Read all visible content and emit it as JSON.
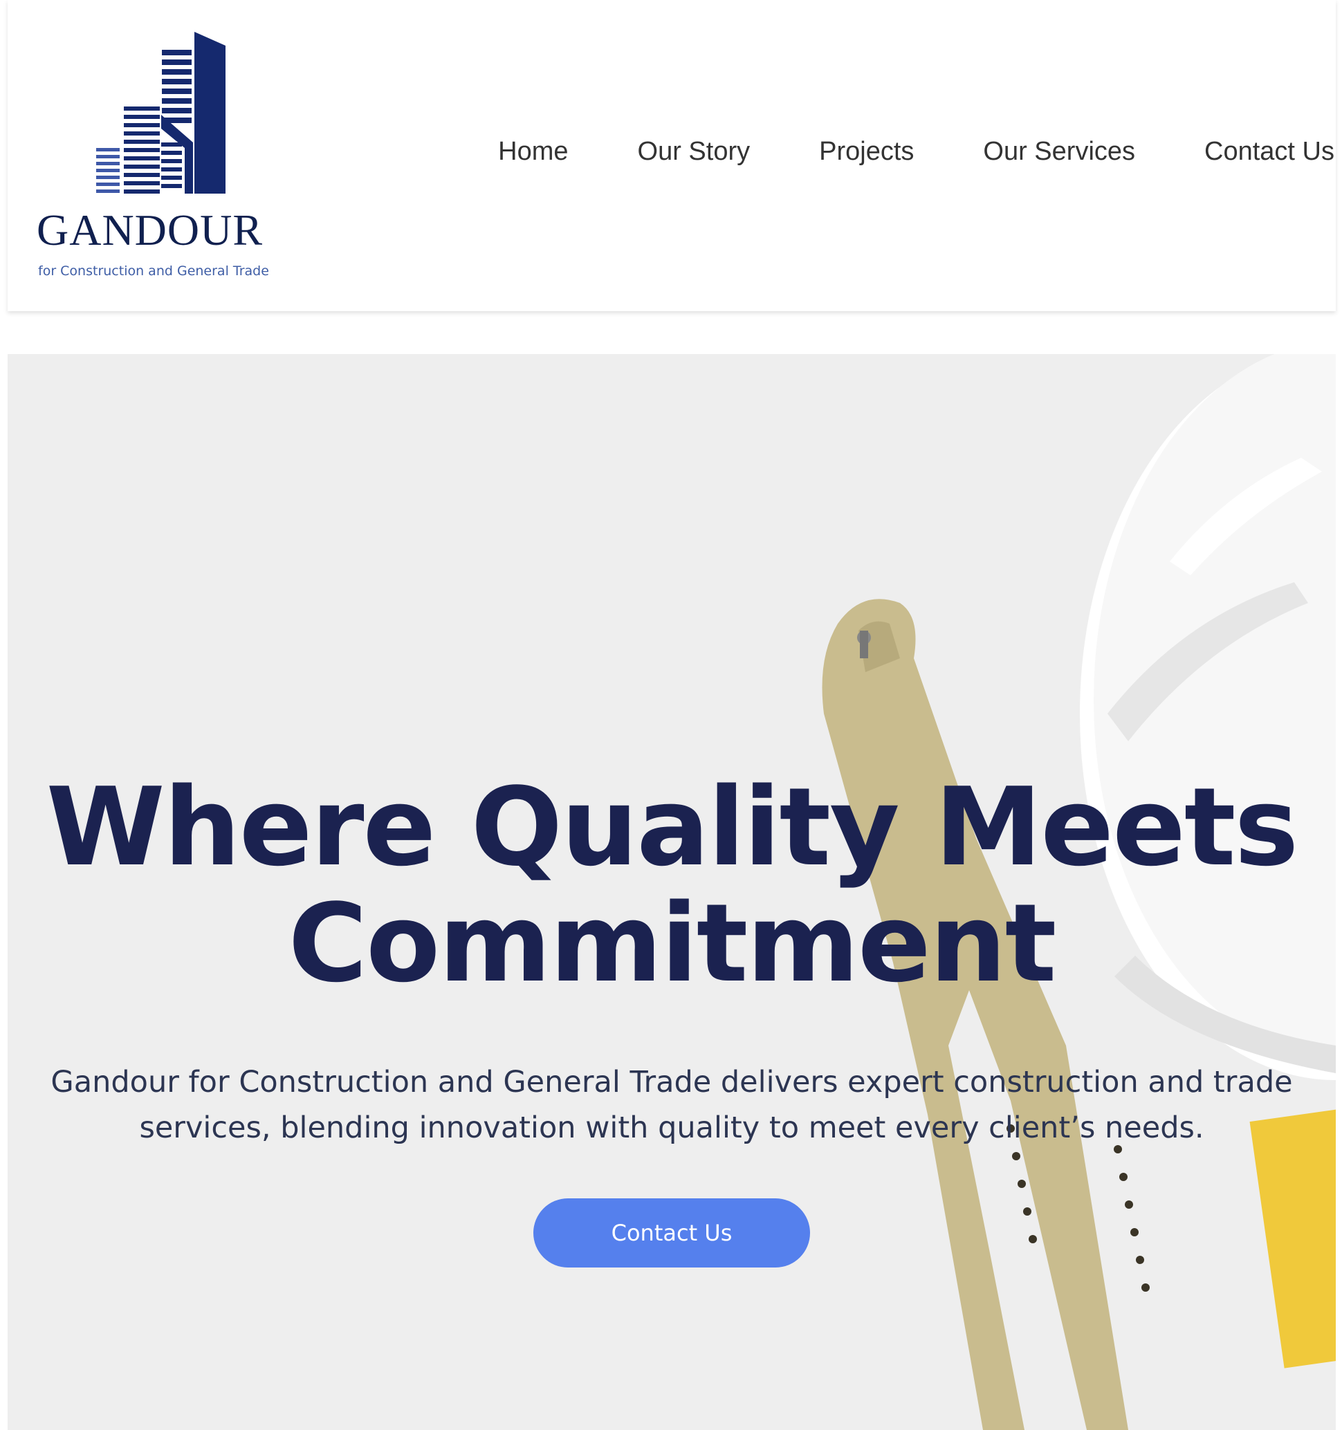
{
  "brand": {
    "name": "GANDOUR",
    "tagline": "for Construction and General Trade",
    "logo_icon": "building-logo-icon"
  },
  "nav": {
    "items": [
      {
        "label": "Home"
      },
      {
        "label": "Our Story"
      },
      {
        "label": "Projects"
      },
      {
        "label": "Our Services"
      },
      {
        "label": "Contact Us"
      }
    ]
  },
  "hero": {
    "title_line1": "Where Quality Meets",
    "title_line2": "Commitment",
    "subtitle": "Gandour for Construction and General Trade delivers expert construction and trade services, blending innovation with quality to meet every client’s needs.",
    "cta_label": "Contact Us"
  },
  "colors": {
    "brand_navy": "#10204f",
    "title_navy": "#1b2250",
    "accent_blue": "#5580ed",
    "hero_bg": "#eeeeee"
  }
}
